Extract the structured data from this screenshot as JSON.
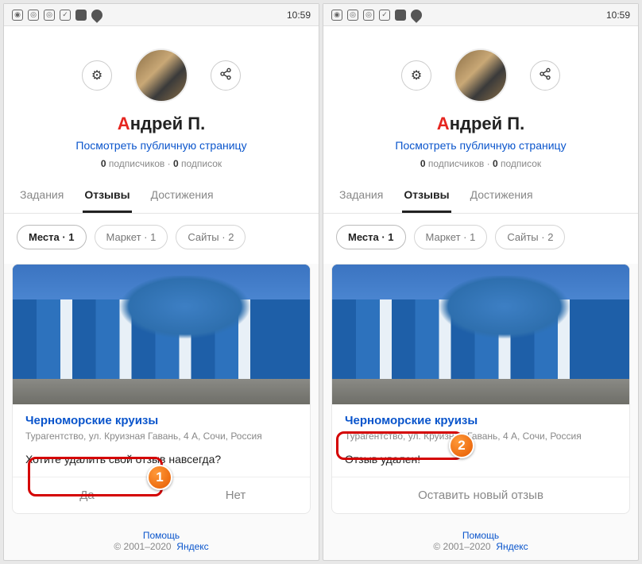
{
  "statusbar": {
    "time": "10:59"
  },
  "profile": {
    "name_first": "А",
    "name_rest": "ндрей П.",
    "public_link": "Посмотреть публичную страницу",
    "subscribers_count": "0",
    "subscribers_label": "подписчиков",
    "subscriptions_count": "0",
    "subscriptions_label": "подписок",
    "separator": " · "
  },
  "tabs": {
    "tasks": "Задания",
    "reviews": "Отзывы",
    "achievements": "Достижения"
  },
  "chips": {
    "places": "Места · 1",
    "market": "Маркет · 1",
    "sites": "Сайты · 2"
  },
  "card": {
    "title": "Черноморские круизы",
    "subtitle": "Турагентство, ул. Круизная Гавань, 4 А, Сочи, Россия",
    "confirm_prompt": "Хотите удалить свой отзыв навсегда?",
    "deleted_msg": "Отзыв удален!",
    "btn_yes": "Да",
    "btn_no": "Нет",
    "btn_new_review": "Оставить новый отзыв"
  },
  "footer": {
    "help": "Помощь",
    "copyright": "© 2001–2020",
    "brand": "Яндекс"
  },
  "annotations": {
    "step1": "1",
    "step2": "2"
  }
}
